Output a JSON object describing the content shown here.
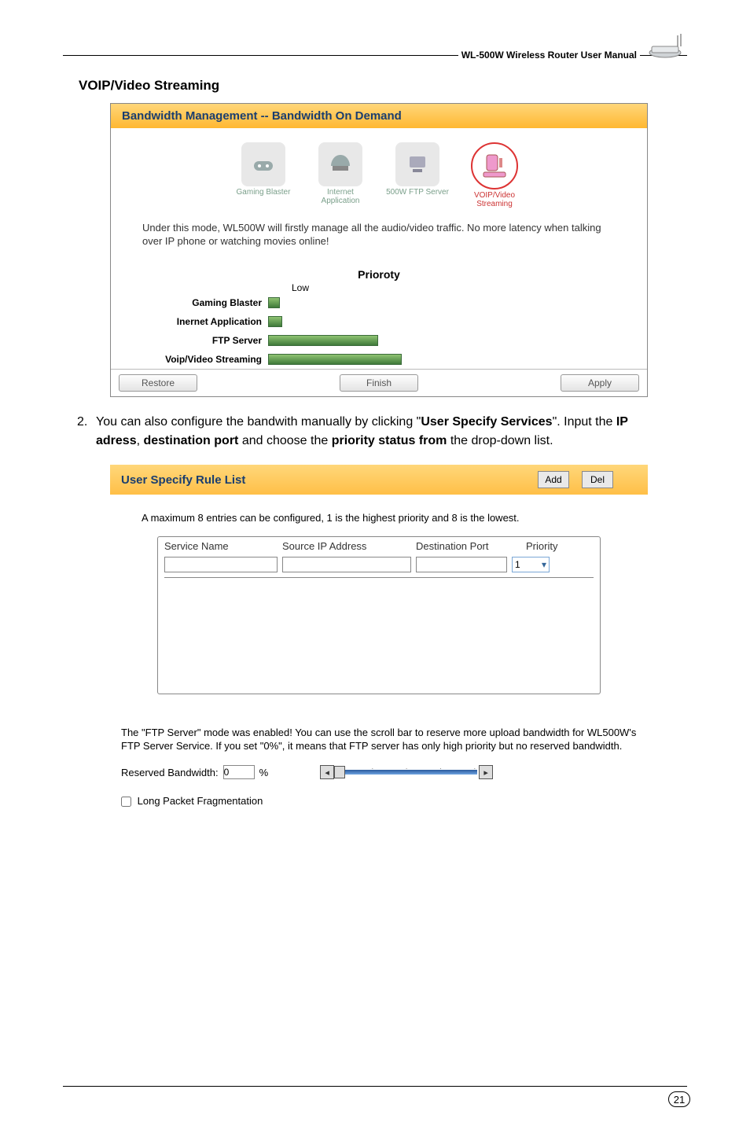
{
  "header": {
    "title": "WL-500W Wireless Router User Manual"
  },
  "section_title": "VOIP/Video Streaming",
  "ss1": {
    "header": "Bandwidth Management -- Bandwidth On Demand",
    "modes": {
      "gaming": "Gaming Blaster",
      "internet": "Internet Application",
      "ftp": "500W FTP Server",
      "voip": "VOIP/Video Streaming"
    },
    "desc": "Under this mode, WL500W will firstly manage all the audio/video traffic. No more latency when talking over IP phone or watching movies online!",
    "priority_title": "Prioroty",
    "low_label": "Low",
    "rows": {
      "gaming": "Gaming Blaster",
      "internet": "Inernet Application",
      "ftp": "FTP Server",
      "voip": "Voip/Video Streaming"
    },
    "buttons": {
      "restore": "Restore",
      "finish": "Finish",
      "apply": "Apply"
    }
  },
  "body_text": {
    "num": "2.",
    "line": "You can also configure the bandwith manually by clicking \"",
    "b1": "User Specify Services",
    "line2": "\". Input the ",
    "b2": "IP adress",
    "c1": ", ",
    "b3": "destination port",
    "line3": " and choose the ",
    "b4": "priority status from",
    "line4": " the drop-down list."
  },
  "ss2": {
    "title": "User Specify Rule List",
    "add": "Add",
    "del": "Del",
    "note": "A maximum 8 entries can be configured, 1 is the highest priority and 8 is the lowest.",
    "headers": {
      "svc": "Service Name",
      "ip": "Source IP Address",
      "dp": "Destination Port",
      "pr": "Priority"
    },
    "priority_value": "1"
  },
  "ftp": {
    "text": "The \"FTP Server\" mode was enabled! You can use the scroll bar to reserve more upload bandwidth for WL500W's FTP Server Service. If you set \"0%\", it means that FTP server has only high priority but no reserved bandwidth.",
    "reserved_label": "Reserved Bandwidth:",
    "reserved_value": "0",
    "percent": "%",
    "lpf": "Long Packet Fragmentation"
  },
  "page_number": "21",
  "chart_data": {
    "type": "bar",
    "orientation": "horizontal",
    "title": "Prioroty",
    "xlabel": "Low",
    "categories": [
      "Gaming Blaster",
      "Inernet Application",
      "FTP Server",
      "Voip/Video Streaming"
    ],
    "values": [
      15,
      18,
      140,
      170
    ],
    "note": "values are approximate pixel bar lengths representing relative priority from Low upward"
  }
}
